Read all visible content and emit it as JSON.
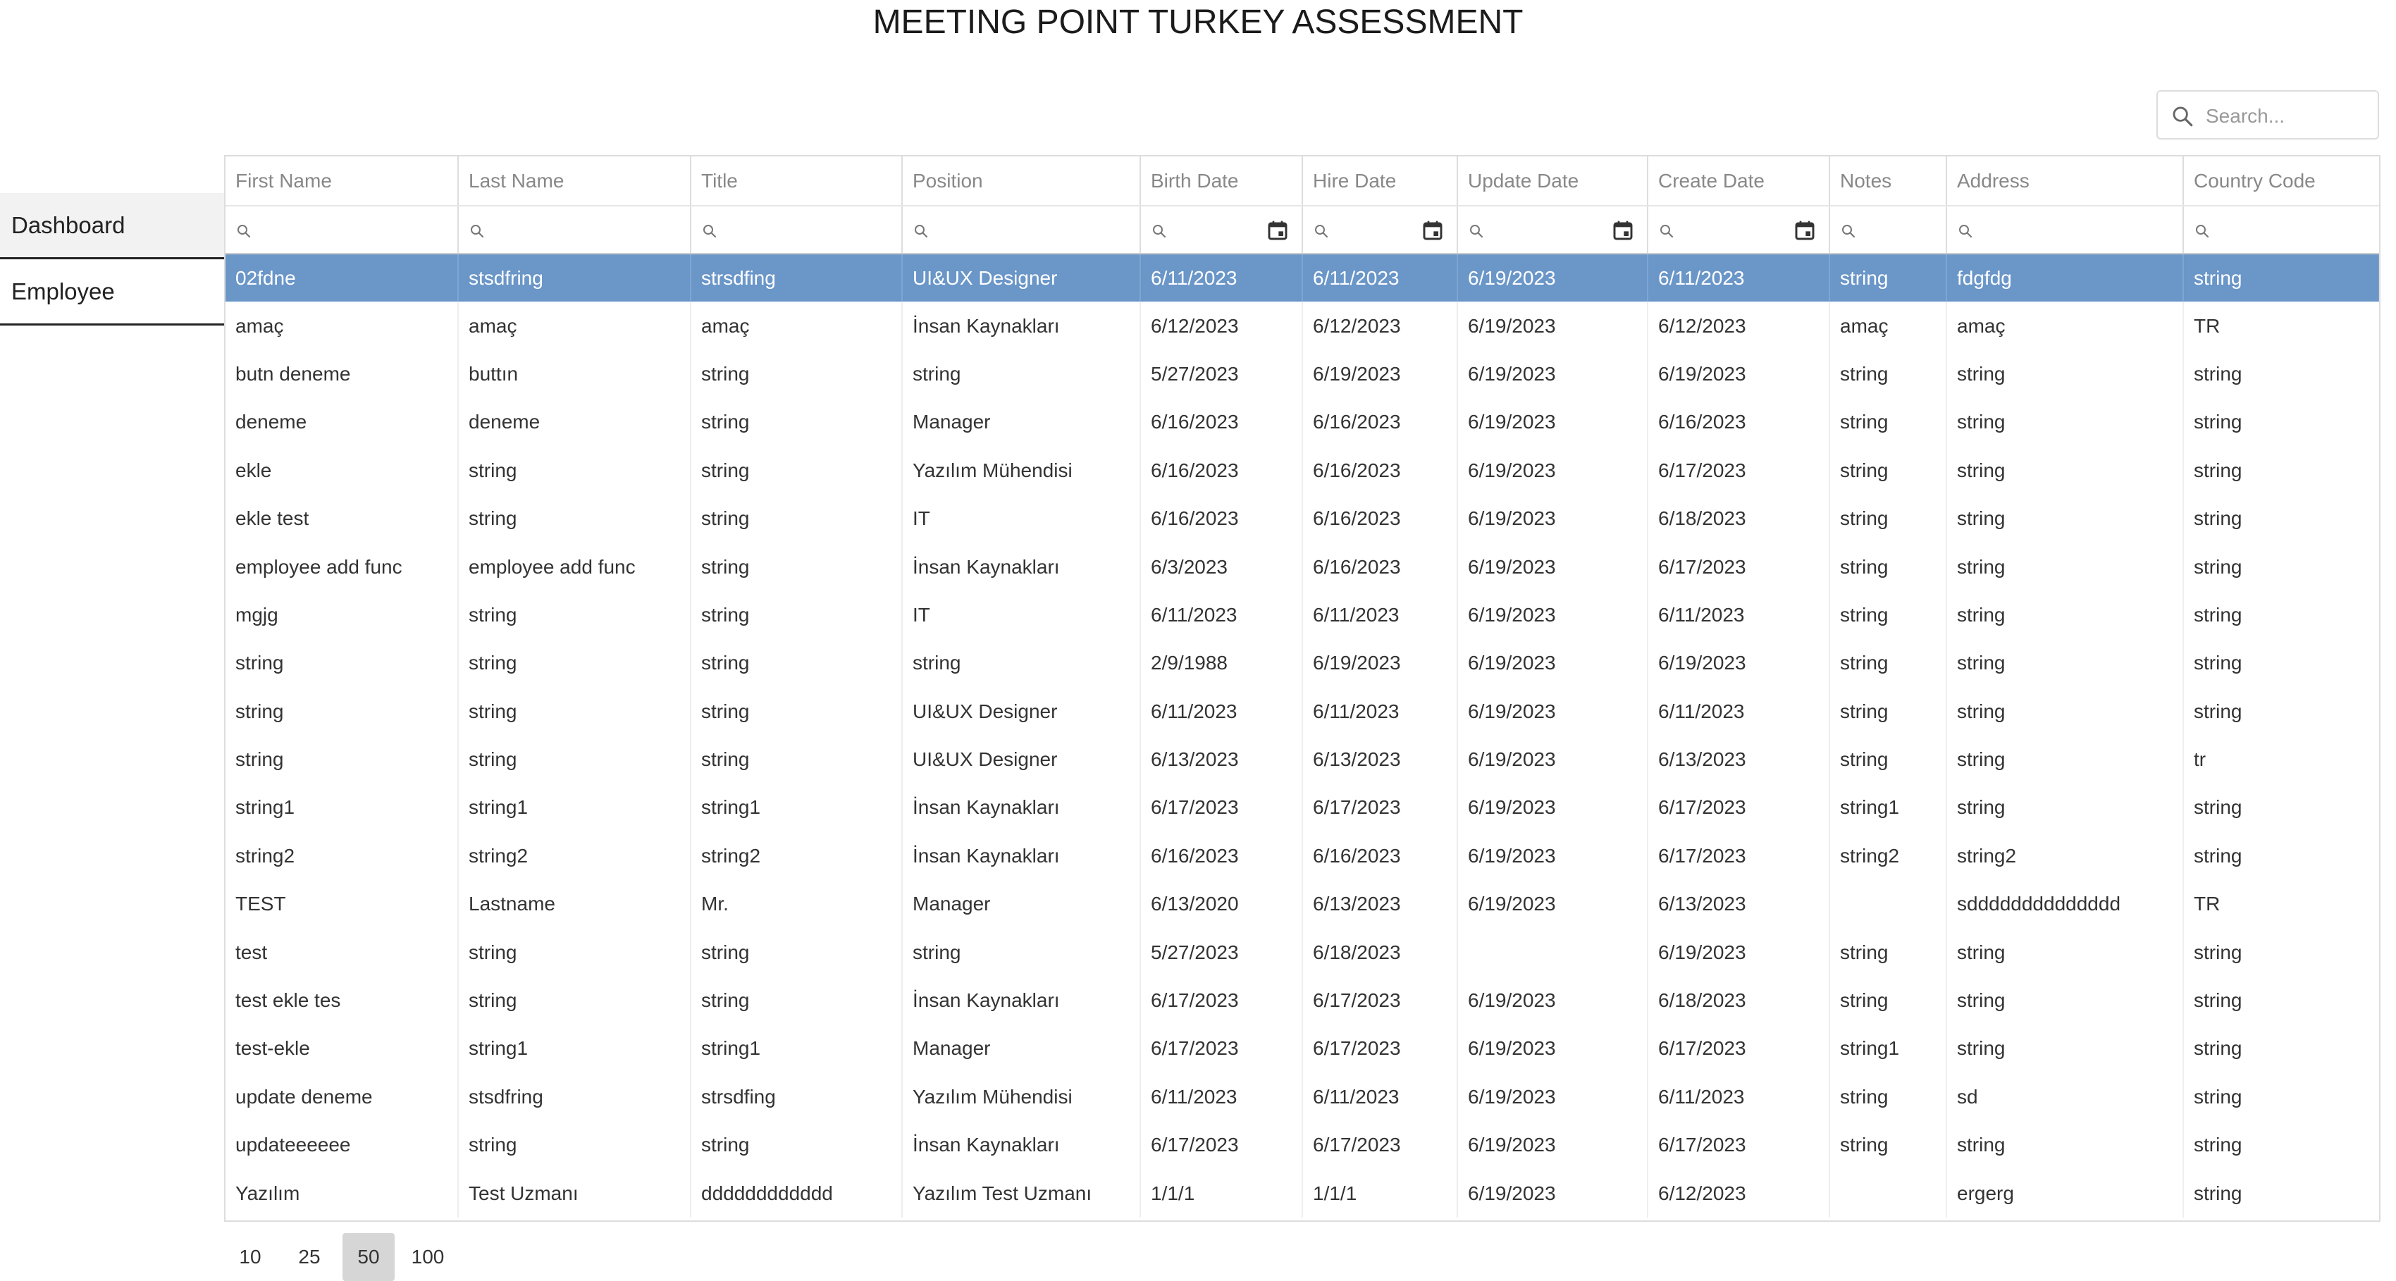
{
  "app_title": "MEETING POINT TURKEY ASSESSMENT",
  "search": {
    "placeholder": "Search...",
    "value": ""
  },
  "sidebar": {
    "items": [
      {
        "label": "Dashboard"
      },
      {
        "label": "Employee"
      }
    ]
  },
  "table": {
    "columns": [
      "First Name",
      "Last Name",
      "Title",
      "Position",
      "Birth Date",
      "Hire Date",
      "Update Date",
      "Create Date",
      "Notes",
      "Address",
      "Country Code"
    ],
    "selected_row": 0,
    "rows": [
      [
        "02fdne",
        "stsdfring",
        "strsdfing",
        "UI&UX Designer",
        "6/11/2023",
        "6/11/2023",
        "6/19/2023",
        "6/11/2023",
        "string",
        "fdgfdg",
        "string"
      ],
      [
        "amaç",
        "amaç",
        "amaç",
        "İnsan Kaynakları",
        "6/12/2023",
        "6/12/2023",
        "6/19/2023",
        "6/12/2023",
        "amaç",
        "amaç",
        "TR"
      ],
      [
        "butn deneme",
        "buttın",
        "string",
        "string",
        "5/27/2023",
        "6/19/2023",
        "6/19/2023",
        "6/19/2023",
        "string",
        "string",
        "string"
      ],
      [
        "deneme",
        "deneme",
        "string",
        "Manager",
        "6/16/2023",
        "6/16/2023",
        "6/19/2023",
        "6/16/2023",
        "string",
        "string",
        "string"
      ],
      [
        "ekle",
        "string",
        "string",
        "Yazılım Mühendisi",
        "6/16/2023",
        "6/16/2023",
        "6/19/2023",
        "6/17/2023",
        "string",
        "string",
        "string"
      ],
      [
        "ekle test",
        "string",
        "string",
        "IT",
        "6/16/2023",
        "6/16/2023",
        "6/19/2023",
        "6/18/2023",
        "string",
        "string",
        "string"
      ],
      [
        "employee add func",
        "employee add func",
        "string",
        "İnsan Kaynakları",
        "6/3/2023",
        "6/16/2023",
        "6/19/2023",
        "6/17/2023",
        "string",
        "string",
        "string"
      ],
      [
        "mgjg",
        "string",
        "string",
        "IT",
        "6/11/2023",
        "6/11/2023",
        "6/19/2023",
        "6/11/2023",
        "string",
        "string",
        "string"
      ],
      [
        "string",
        "string",
        "string",
        "string",
        "2/9/1988",
        "6/19/2023",
        "6/19/2023",
        "6/19/2023",
        "string",
        "string",
        "string"
      ],
      [
        "string",
        "string",
        "string",
        "UI&UX Designer",
        "6/11/2023",
        "6/11/2023",
        "6/19/2023",
        "6/11/2023",
        "string",
        "string",
        "string"
      ],
      [
        "string",
        "string",
        "string",
        "UI&UX Designer",
        "6/13/2023",
        "6/13/2023",
        "6/19/2023",
        "6/13/2023",
        "string",
        "string",
        "tr"
      ],
      [
        "string1",
        "string1",
        "string1",
        "İnsan Kaynakları",
        "6/17/2023",
        "6/17/2023",
        "6/19/2023",
        "6/17/2023",
        "string1",
        "string",
        "string"
      ],
      [
        "string2",
        "string2",
        "string2",
        "İnsan Kaynakları",
        "6/16/2023",
        "6/16/2023",
        "6/19/2023",
        "6/17/2023",
        "string2",
        "string2",
        "string"
      ],
      [
        "TEST",
        "Lastname",
        "Mr.",
        "Manager",
        "6/13/2020",
        "6/13/2023",
        "6/19/2023",
        "6/13/2023",
        "",
        "sdddddddddddddd",
        "TR"
      ],
      [
        "test",
        "string",
        "string",
        "string",
        "5/27/2023",
        "6/18/2023",
        "",
        "6/19/2023",
        "string",
        "string",
        "string"
      ],
      [
        "test ekle tes",
        "string",
        "string",
        "İnsan Kaynakları",
        "6/17/2023",
        "6/17/2023",
        "6/19/2023",
        "6/18/2023",
        "string",
        "string",
        "string"
      ],
      [
        "test-ekle",
        "string1",
        "string1",
        "Manager",
        "6/17/2023",
        "6/17/2023",
        "6/19/2023",
        "6/17/2023",
        "string1",
        "string",
        "string"
      ],
      [
        "update deneme",
        "stsdfring",
        "strsdfing",
        "Yazılım Mühendisi",
        "6/11/2023",
        "6/11/2023",
        "6/19/2023",
        "6/11/2023",
        "string",
        "sd",
        "string"
      ],
      [
        "updateeeeee",
        "string",
        "string",
        "İnsan Kaynakları",
        "6/17/2023",
        "6/17/2023",
        "6/19/2023",
        "6/17/2023",
        "string",
        "string",
        "string"
      ],
      [
        "Yazılım",
        "Test Uzmanı",
        "dddddddddddd",
        "Yazılım Test Uzmanı",
        "1/1/1",
        "1/1/1",
        "6/19/2023",
        "6/12/2023",
        "",
        "ergerg",
        "string"
      ]
    ]
  },
  "pagination": {
    "sizes": [
      "10",
      "25",
      "50",
      "100"
    ],
    "active_index": 2
  },
  "colors": {
    "selected_row": "#6a96c8",
    "accent": "#6a96c8"
  },
  "icons": {
    "search": "search-icon",
    "calendar": "calendar-icon",
    "filter": "filter-search-icon"
  }
}
